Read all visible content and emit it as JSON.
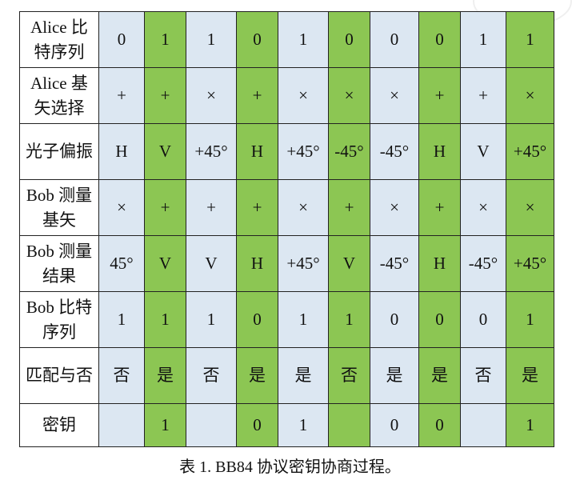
{
  "table": {
    "rows": [
      {
        "header": [
          "Alice 比",
          "特序列"
        ],
        "cells": [
          "0",
          "1",
          "1",
          "0",
          "1",
          "0",
          "0",
          "0",
          "1",
          "1"
        ]
      },
      {
        "header": [
          "Alice 基",
          "矢选择"
        ],
        "cells": [
          "+",
          "+",
          "×",
          "+",
          "×",
          "×",
          "×",
          "+",
          "+",
          "×"
        ]
      },
      {
        "header": [
          "光子偏振"
        ],
        "cells": [
          "H",
          "V",
          "+45°",
          "H",
          "+45°",
          "-45°",
          "-45°",
          "H",
          "V",
          "+45°"
        ]
      },
      {
        "header": [
          "Bob 测量",
          "基矢"
        ],
        "cells": [
          "×",
          "+",
          "+",
          "+",
          "×",
          "+",
          "×",
          "+",
          "×",
          "×"
        ]
      },
      {
        "header": [
          "Bob 测量",
          "结果"
        ],
        "cells": [
          "45°",
          "V",
          "V",
          "H",
          "+45°",
          "V",
          "-45°",
          "H",
          "-45°",
          "+45°"
        ]
      },
      {
        "header": [
          "Bob 比特",
          "序列"
        ],
        "cells": [
          "1",
          "1",
          "1",
          "0",
          "1",
          "1",
          "0",
          "0",
          "0",
          "1"
        ]
      },
      {
        "header": [
          "匹配与否"
        ],
        "cells": [
          "否",
          "是",
          "否",
          "是",
          "是",
          "否",
          "是",
          "是",
          "否",
          "是"
        ]
      },
      {
        "header": [
          "密钥"
        ],
        "cells": [
          "",
          "1",
          "",
          "0",
          "1",
          "",
          "0",
          "0",
          "",
          "1"
        ]
      }
    ],
    "column_colors": {
      "light": "#dce7f2",
      "green": "#8cc653"
    }
  },
  "caption": "表 1. BB84 协议密钥协商过程。"
}
